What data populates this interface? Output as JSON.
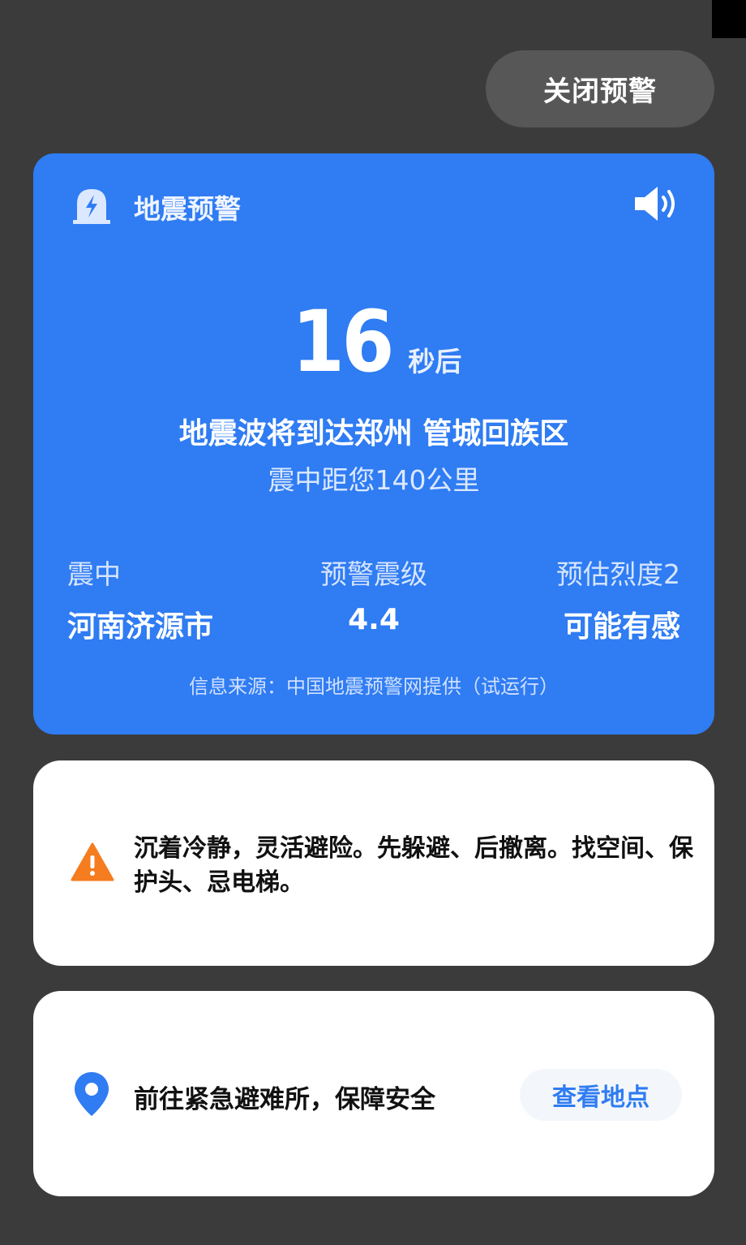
{
  "header": {
    "close_button_label": "关闭预警"
  },
  "alert": {
    "title": "地震预警",
    "countdown_value": "16",
    "countdown_unit": "秒后",
    "arrival_text": "地震波将到达郑州 管城回族区",
    "distance_text": "震中距您140公里",
    "epicenter_label": "震中",
    "epicenter_value": "河南济源市",
    "magnitude_label": "预警震级",
    "magnitude_value": "4.4",
    "intensity_label": "预估烈度2",
    "intensity_value": "可能有感",
    "source_text": "信息来源：中国地震预警网提供（试运行）",
    "icons": {
      "title": "earthquake-alert-icon",
      "sound": "speaker-icon"
    }
  },
  "tip": {
    "text": "沉着冷静，灵活避险。先躲避、后撤离。找空间、保护头、忌电梯。",
    "icon": "warning-triangle-icon"
  },
  "shelter": {
    "text": "前往紧急避难所，保障安全",
    "button_label": "查看地点",
    "icon": "location-pin-icon"
  },
  "colors": {
    "background": "#3b3b3b",
    "alert_blue": "#2f7cf3",
    "warning_orange": "#f57c1f",
    "card_white": "#ffffff"
  }
}
